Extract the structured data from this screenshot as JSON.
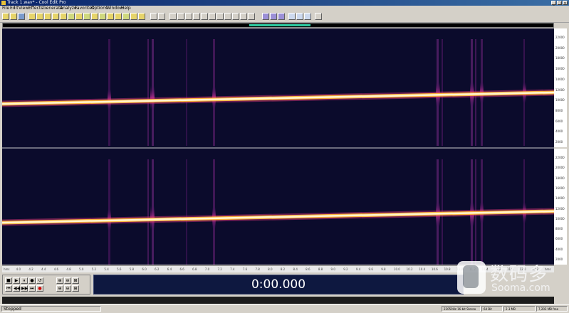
{
  "window": {
    "title": "Track 1.wav* - Cool Edit Pro",
    "controls": [
      "_",
      "□",
      "×"
    ]
  },
  "menu": [
    "File",
    "Edit",
    "View",
    "Effects",
    "Generate",
    "Analyze",
    "Favorites",
    "Options",
    "Window",
    "Help"
  ],
  "toolbar": {
    "buttons": [
      "new-file",
      "open",
      "save",
      "cut",
      "copy",
      "paste",
      "undo",
      "redo",
      "mix",
      "zoom",
      "edit",
      "spectral",
      "loop",
      "marker",
      "cue",
      "multitrack",
      "frequency-analysis",
      "scripts",
      "help"
    ]
  },
  "frequency_ruler": {
    "top_channel": [
      "22000",
      "20000",
      "18000",
      "16000",
      "14000",
      "12000",
      "10000",
      "8000",
      "6000",
      "4000",
      "2000"
    ],
    "bottom_channel": [
      "22000",
      "20000",
      "18000",
      "16000",
      "14000",
      "12000",
      "10000",
      "8000",
      "6000",
      "4000",
      "2000"
    ]
  },
  "timeline": {
    "labels": [
      "hms",
      "4.0",
      "4.2",
      "4.4",
      "4.6",
      "4.8",
      "5.0",
      "5.2",
      "5.4",
      "5.6",
      "5.8",
      "6.0",
      "6.2",
      "6.4",
      "6.6",
      "6.8",
      "7.0",
      "7.2",
      "7.4",
      "7.6",
      "7.8",
      "8.0",
      "8.2",
      "8.4",
      "8.6",
      "8.8",
      "9.0",
      "9.2",
      "9.4",
      "9.6",
      "9.8",
      "10.0",
      "10.2",
      "10.4",
      "10.6",
      "10.8",
      "11.0",
      "11.2",
      "11.4",
      "11.6",
      "11.8",
      "12.0",
      "12.2",
      "hms"
    ]
  },
  "transport": {
    "row1": [
      "■",
      "▶",
      "⏸",
      "●",
      "↺"
    ],
    "row2": [
      "⏮",
      "◀◀",
      "▶▶",
      "⏭",
      "●"
    ],
    "zoom": [
      "⊕",
      "⊖",
      "⊞",
      "⊕",
      "⊖",
      "⊞"
    ]
  },
  "time_display": "0:00.000",
  "status": {
    "state": "Stopped",
    "sample": "22050Hz 16-bit Stereo",
    "format": "64 Bit",
    "size": "2.3 MB",
    "free": "7,203 MB free"
  },
  "watermark": {
    "cn": "数码多",
    "en": "Sooma.com"
  },
  "colors": {
    "spectrum_bg": "#0b0b2c",
    "sweep_core": "#fff6d0",
    "sweep_glow": "#ffb43c",
    "time_display_bg": "#0e1840",
    "overview_range": "#2ec9a0"
  }
}
